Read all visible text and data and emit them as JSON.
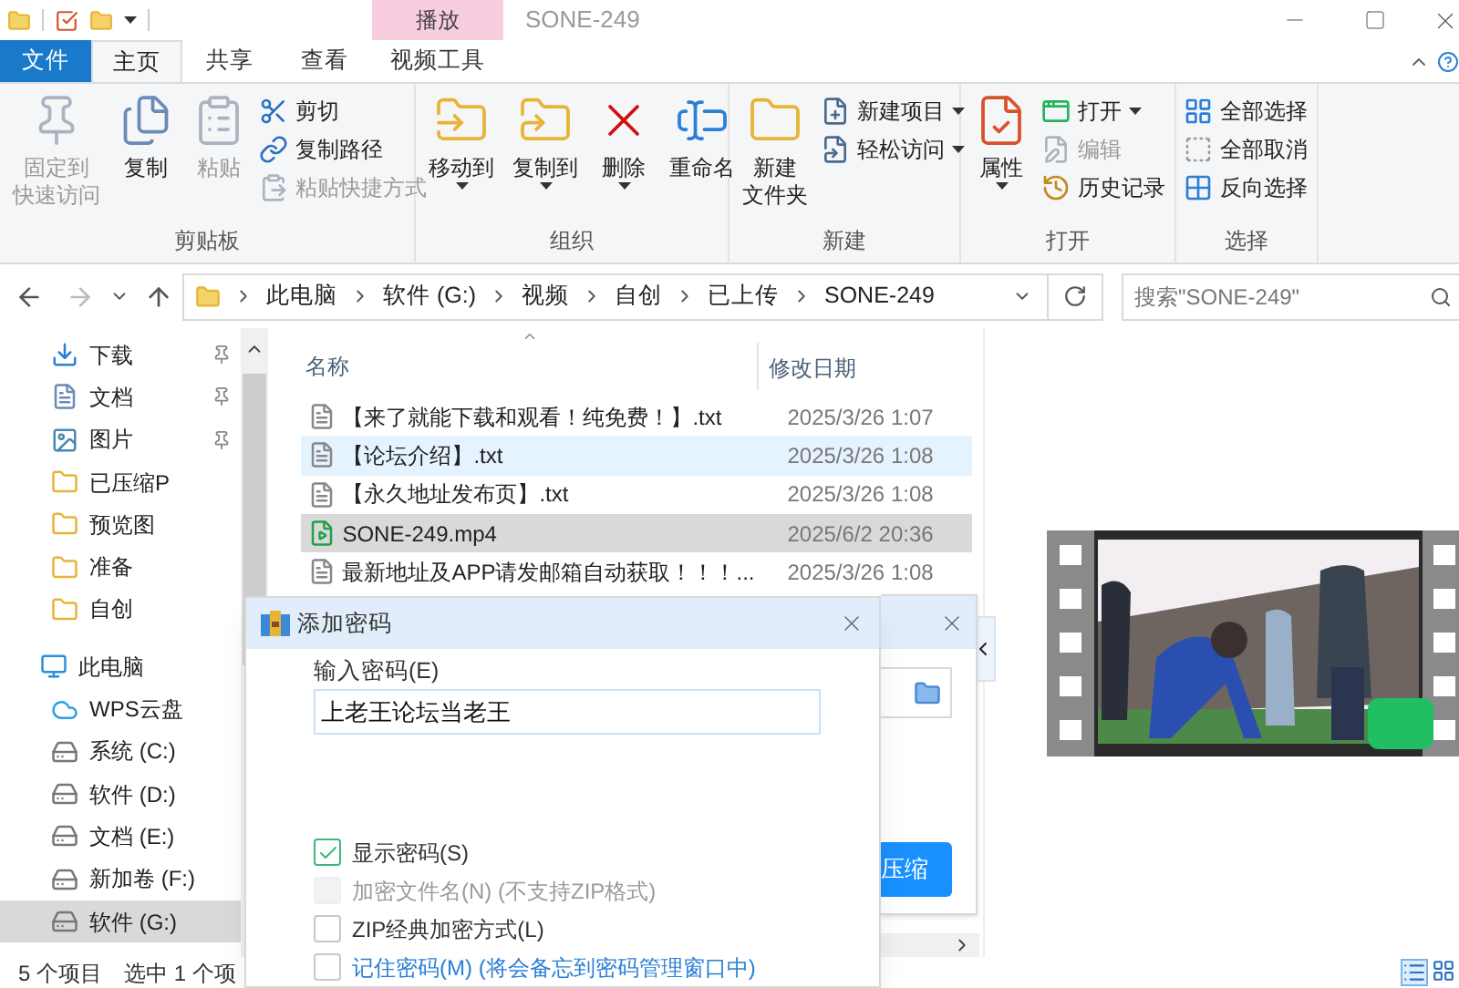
{
  "title_bar": {
    "context_tab": "播放",
    "title": "SONE-249"
  },
  "ribbon_tabs": [
    {
      "label": "文件",
      "kind": "file",
      "selected": false
    },
    {
      "label": "主页",
      "kind": "tab",
      "selected": true
    },
    {
      "label": "共享",
      "kind": "tab",
      "selected": false
    },
    {
      "label": "查看",
      "kind": "tab",
      "selected": false
    },
    {
      "label": "视频工具",
      "kind": "tab",
      "selected": false
    }
  ],
  "ribbon_groups": [
    {
      "label": "剪贴板",
      "items": [
        {
          "kind": "large",
          "lines": [
            "固定到",
            "快速访问"
          ],
          "disabled": true,
          "dropdown": false
        },
        {
          "kind": "large",
          "lines": [
            "复制"
          ],
          "disabled": false,
          "dropdown": false
        },
        {
          "kind": "large",
          "lines": [
            "粘贴"
          ],
          "disabled": true,
          "dropdown": false
        },
        {
          "kind": "small",
          "lines": [
            "剪切"
          ],
          "disabled": false,
          "dropdown": false
        },
        {
          "kind": "small",
          "lines": [
            "复制路径"
          ],
          "disabled": false,
          "dropdown": false
        },
        {
          "kind": "small",
          "lines": [
            "粘贴快捷方式"
          ],
          "disabled": true,
          "dropdown": false
        }
      ]
    },
    {
      "label": "组织",
      "items": [
        {
          "kind": "large",
          "lines": [
            "移动到"
          ],
          "disabled": false,
          "dropdown": true
        },
        {
          "kind": "large",
          "lines": [
            "复制到"
          ],
          "disabled": false,
          "dropdown": true
        },
        {
          "kind": "large",
          "lines": [
            "删除"
          ],
          "disabled": false,
          "dropdown": true
        },
        {
          "kind": "large",
          "lines": [
            "重命名"
          ],
          "disabled": false,
          "dropdown": false
        }
      ]
    },
    {
      "label": "新建",
      "items": [
        {
          "kind": "large",
          "lines": [
            "新建",
            "文件夹"
          ],
          "disabled": false,
          "dropdown": false
        },
        {
          "kind": "small",
          "lines": [
            "新建项目"
          ],
          "disabled": false,
          "dropdown": true
        },
        {
          "kind": "small",
          "lines": [
            "轻松访问"
          ],
          "disabled": false,
          "dropdown": true
        }
      ]
    },
    {
      "label": "打开",
      "items": [
        {
          "kind": "large",
          "lines": [
            "属性"
          ],
          "disabled": false,
          "dropdown": true
        },
        {
          "kind": "small",
          "lines": [
            "打开"
          ],
          "disabled": false,
          "dropdown": true
        },
        {
          "kind": "small",
          "lines": [
            "编辑"
          ],
          "disabled": true,
          "dropdown": false
        },
        {
          "kind": "small",
          "lines": [
            "历史记录"
          ],
          "disabled": false,
          "dropdown": false
        }
      ]
    },
    {
      "label": "选择",
      "items": [
        {
          "kind": "small",
          "lines": [
            "全部选择"
          ],
          "disabled": false,
          "dropdown": false
        },
        {
          "kind": "small",
          "lines": [
            "全部取消"
          ],
          "disabled": false,
          "dropdown": false
        },
        {
          "kind": "small",
          "lines": [
            "反向选择"
          ],
          "disabled": false,
          "dropdown": false
        }
      ]
    }
  ],
  "address_bar": {
    "crumbs": [
      "此电脑",
      "软件 (G:)",
      "视频",
      "自创",
      "已上传",
      "SONE-249"
    ]
  },
  "search": {
    "placeholder": "搜索\"SONE-249\""
  },
  "sidebar": {
    "items": [
      {
        "label": "下载",
        "pinned": true,
        "selected": false
      },
      {
        "label": "文档",
        "pinned": true,
        "selected": false
      },
      {
        "label": "图片",
        "pinned": true,
        "selected": false
      },
      {
        "label": "已压缩P",
        "pinned": false,
        "selected": false
      },
      {
        "label": "预览图",
        "pinned": false,
        "selected": false
      },
      {
        "label": "准备",
        "pinned": false,
        "selected": false
      },
      {
        "label": "自创",
        "pinned": false,
        "selected": false
      },
      {
        "label": "此电脑",
        "pinned": false,
        "selected": false,
        "children": [
          {
            "label": "WPS云盘",
            "selected": false
          },
          {
            "label": "系统 (C:)",
            "selected": false
          },
          {
            "label": "软件 (D:)",
            "selected": false
          },
          {
            "label": "文档 (E:)",
            "selected": false
          },
          {
            "label": "新加卷 (F:)",
            "selected": false
          },
          {
            "label": "软件 (G:)",
            "selected": true
          }
        ]
      }
    ]
  },
  "file_list": {
    "columns": [
      "名称",
      "修改日期"
    ],
    "rows": [
      {
        "name": "【来了就能下载和观看！纯免费！】.txt",
        "date": "2025/3/26 1:07",
        "kind": "text",
        "hovered": false,
        "selected": false
      },
      {
        "name": "【论坛介绍】.txt",
        "date": "2025/3/26 1:08",
        "kind": "text",
        "hovered": true,
        "selected": false
      },
      {
        "name": "【永久地址发布页】.txt",
        "date": "2025/3/26 1:08",
        "kind": "text",
        "hovered": false,
        "selected": false
      },
      {
        "name": "SONE-249.mp4",
        "date": "2025/6/2 20:36",
        "kind": "video",
        "hovered": false,
        "selected": true
      },
      {
        "name": "最新地址及APP请发邮箱自动获取！！！...",
        "date": "2025/3/26 1:08",
        "kind": "text",
        "hovered": false,
        "selected": false
      }
    ]
  },
  "status_bar": {
    "count": "5 个项目",
    "selection": "选中 1 个项"
  },
  "compress_window": {
    "button": "压缩"
  },
  "password_dialog": {
    "title": "添加密码",
    "field_label": "输入密码(E)",
    "password": "上老王论坛当老王",
    "options": [
      {
        "label": "显示密码(S)",
        "checked": true,
        "disabled": false,
        "hovered": false
      },
      {
        "label": "加密文件名(N) (不支持ZIP格式)",
        "checked": false,
        "disabled": true,
        "hovered": false
      },
      {
        "label": "ZIP经典加密方式(L)",
        "checked": false,
        "disabled": false,
        "hovered": false
      },
      {
        "label": "记住密码(M) (将会备忘到密码管理窗口中)",
        "checked": false,
        "disabled": false,
        "hovered": true
      }
    ]
  }
}
